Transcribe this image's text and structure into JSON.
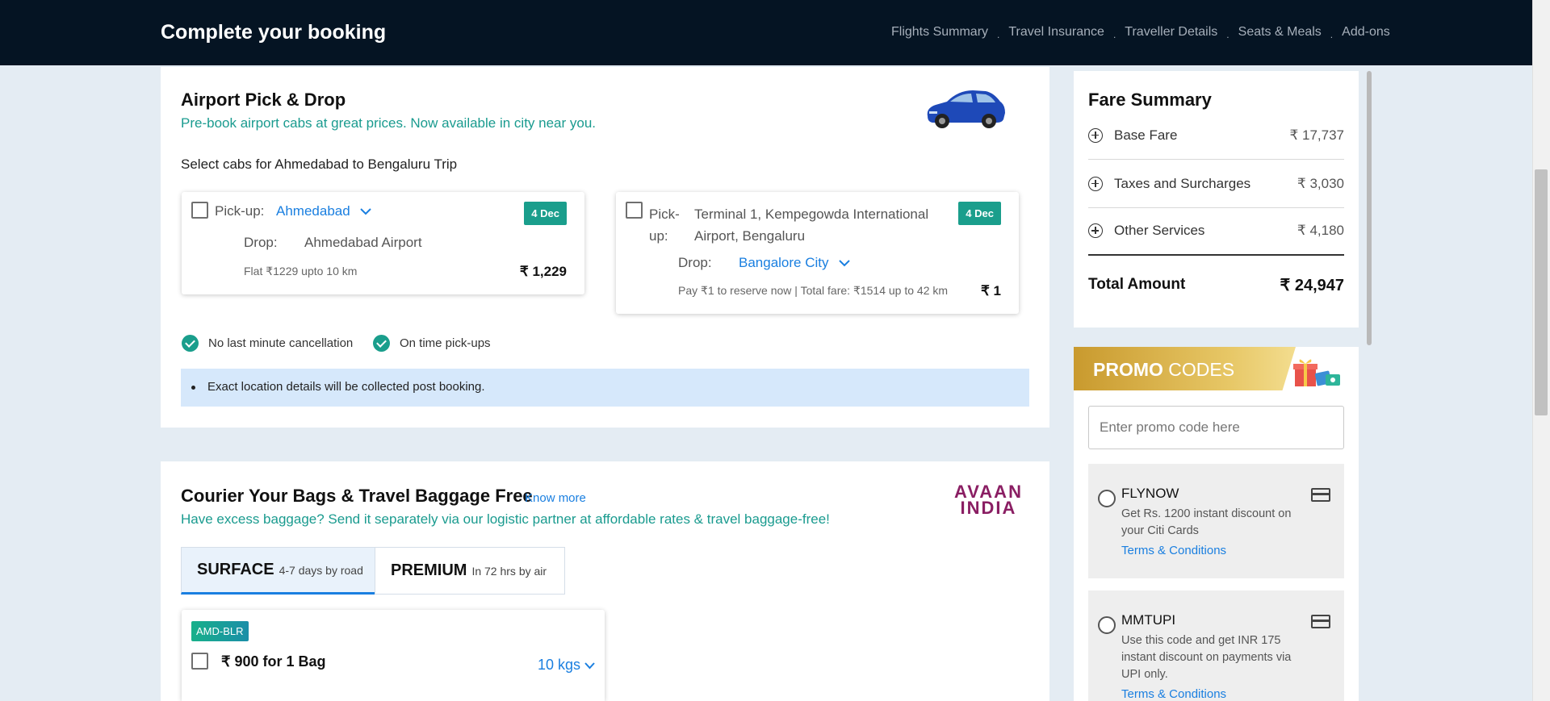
{
  "header": {
    "title": "Complete your booking",
    "steps": [
      "Flights Summary",
      "Travel Insurance",
      "Traveller Details",
      "Seats & Meals",
      "Add-ons"
    ],
    "separator": "."
  },
  "airport_cab": {
    "title": "Airport Pick & Drop",
    "subtitle": "Pre-book airport cabs at great prices. Now available in city near you.",
    "select_label": "Select cabs for Ahmedabad to Bengaluru Trip",
    "option1": {
      "pickup_label": "Pick-up:",
      "pickup_value": "Ahmedabad",
      "drop_label": "Drop:",
      "drop_value": "Ahmedabad Airport",
      "date": "4 Dec",
      "note": "Flat ₹1229 upto 10 km",
      "price": "₹ 1,229"
    },
    "option2": {
      "pickup_label_line1": "Pick-",
      "pickup_label_line2": "up:",
      "pickup_value_line1": "Terminal 1, Kempegowda International",
      "pickup_value_line2": "Airport, Bengaluru",
      "drop_label": "Drop:",
      "drop_value": "Bangalore City",
      "date": "4 Dec",
      "note": "Pay ₹1 to reserve now | Total fare: ₹1514 up to 42 km",
      "price": "₹ 1"
    },
    "features": [
      "No last minute cancellation",
      "On time pick-ups"
    ],
    "info": "Exact location details will be collected post booking."
  },
  "courier": {
    "title": "Courier Your Bags & Travel Baggage Free",
    "know_more": "Know more",
    "subtitle": "Have excess baggage? Send it separately via our logistic partner at affordable rates & travel baggage-free!",
    "logo_line1": "AVAAN",
    "logo_line2": "INDIA",
    "tabs": [
      {
        "name": "SURFACE",
        "detail": "4-7 days by road"
      },
      {
        "name": "PREMIUM",
        "detail": "In 72 hrs by air"
      }
    ],
    "route_badge": "AMD-BLR",
    "bag_price": "₹ 900 for 1 Bag",
    "weight": "10 kgs"
  },
  "fare_summary": {
    "title": "Fare Summary",
    "rows": [
      {
        "label": "Base Fare",
        "value": "₹ 17,737"
      },
      {
        "label": "Taxes and Surcharges",
        "value": "₹ 3,030"
      },
      {
        "label": "Other Services",
        "value": "₹ 4,180"
      }
    ],
    "total_label": "Total Amount",
    "total_value": "₹ 24,947"
  },
  "promo": {
    "title_bold": "PROMO",
    "title_light": "CODES",
    "placeholder": "Enter promo code here",
    "codes": [
      {
        "code": "FLYNOW",
        "desc": "Get Rs. 1200 instant discount on your Citi Cards",
        "tnc": "Terms & Conditions"
      },
      {
        "code": "MMTUPI",
        "desc": "Use this code and get INR 175 instant discount on payments via UPI only.",
        "tnc": "Terms & Conditions"
      }
    ]
  },
  "colors": {
    "header_bg": "#051423",
    "teal": "#1a9e8c",
    "link_blue": "#1a7fe0",
    "page_bg": "#e4ecf3"
  }
}
